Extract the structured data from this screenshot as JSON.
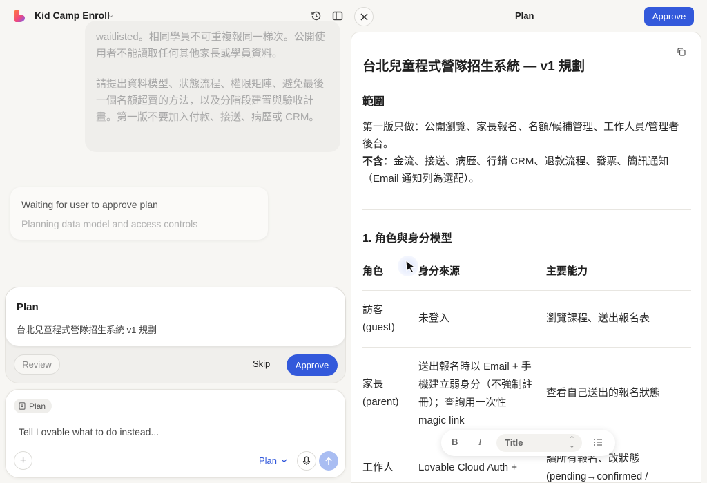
{
  "app": {
    "title": "Kid Camp Enroll"
  },
  "chat": {
    "user_message_p1": "waitlisted。相同學員不可重複報同一梯次。公開使用者不能讀取任何其他家長或學員資料。",
    "user_message_p2": "請提出資料模型、狀態流程、權限矩陣、避免最後一個名額超賣的方法，以及分階段建置與驗收計畫。第一版不要加入付款、接送、病歷或 CRM。",
    "status_title": "Waiting for user to approve plan",
    "status_sub": "Planning data model and access controls"
  },
  "plan_card": {
    "label": "Plan",
    "description": "台北兒童程式營隊招生系統 v1 規劃",
    "review": "Review",
    "skip": "Skip",
    "approve": "Approve"
  },
  "composer": {
    "chip": "Plan",
    "placeholder": "Tell Lovable what to do instead...",
    "mode": "Plan"
  },
  "right_panel": {
    "title": "Plan",
    "approve": "Approve"
  },
  "doc": {
    "title": "台北兒童程式營隊招生系統 — v1 規劃",
    "scope_heading": "範圍",
    "scope_line1": "第一版只做：公開瀏覽、家長報名、名額/候補管理、工作人員/管理者後台。",
    "scope_excl_label": "不含",
    "scope_excl_text": "：金流、接送、病歷、行銷 CRM、退款流程、發票、簡訊通知（Email 通知列為選配）。",
    "roles_heading": "1. 角色與身分模型",
    "table": {
      "headers": [
        "角色",
        "身分來源",
        "主要能力"
      ],
      "rows": [
        {
          "role": "訪客\n(guest)",
          "source": "未登入",
          "ability": "瀏覽課程、送出報名表"
        },
        {
          "role": "家長\n(parent)",
          "source": "送出報名時以 Email + 手機建立弱身分（不強制註冊）；查詢用一次性 magic link",
          "ability": "查看自己送出的報名狀態"
        },
        {
          "role": "工作人",
          "source": "Lovable Cloud Auth +",
          "ability": "讀所有報名、改狀態\n(pending→confirmed /"
        }
      ]
    }
  },
  "format_toolbar": {
    "bold": "B",
    "italic": "I",
    "style": "Title"
  }
}
